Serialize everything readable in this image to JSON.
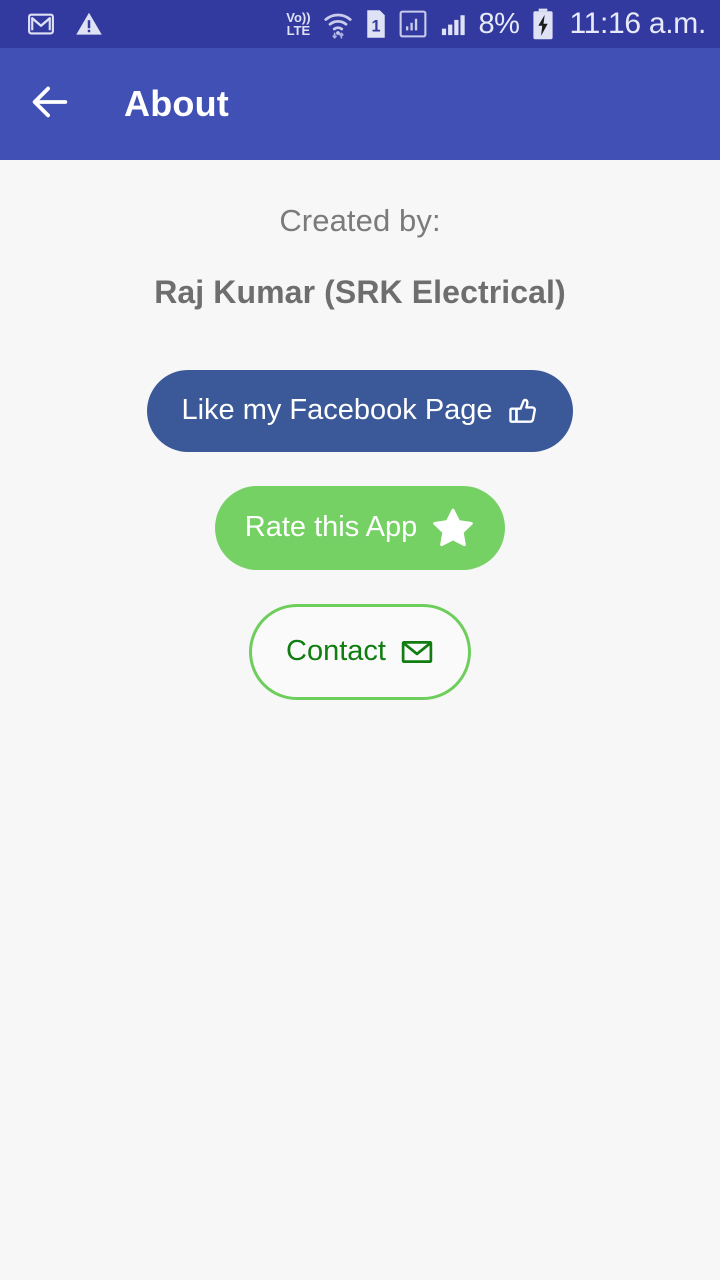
{
  "status_bar": {
    "background": "#323aa0",
    "left_icons": [
      {
        "name": "gmail-icon",
        "label": "Gmail"
      },
      {
        "name": "warning-triangle-icon",
        "label": "Warning"
      }
    ],
    "right_icons": [
      {
        "name": "volte-icon",
        "top": "Vo))",
        "bottom": "LTE"
      },
      {
        "name": "wifi-icon",
        "label": "Wi-Fi"
      },
      {
        "name": "sim-1-icon",
        "label": "1"
      },
      {
        "name": "signal-boxed-icon",
        "label": "Signal"
      },
      {
        "name": "signal-bars-icon",
        "label": "Signal"
      }
    ],
    "battery_percent": "8%",
    "battery_state": "charging",
    "time": "11:16 a.m."
  },
  "app_bar": {
    "background": "#4150b5",
    "back_icon": "arrow-left-icon",
    "title": "About"
  },
  "content": {
    "created_by_label": "Created by:",
    "author_name": "Raj Kumar (SRK Electrical)",
    "buttons": [
      {
        "id": "facebook",
        "label": "Like my Facebook Page",
        "icon": "thumbs-up-icon",
        "background": "#3b5998",
        "text_color": "#ffffff"
      },
      {
        "id": "rate",
        "label": "Rate this App",
        "icon": "star-icon",
        "background": "#76d164",
        "text_color": "#ffffff"
      },
      {
        "id": "contact",
        "label": "Contact",
        "icon": "envelope-icon",
        "background": "#fafafa",
        "text_color": "#0f7d0f",
        "border_color": "#6ece5c"
      }
    ]
  },
  "page": {
    "background": "#f7f7f7"
  }
}
